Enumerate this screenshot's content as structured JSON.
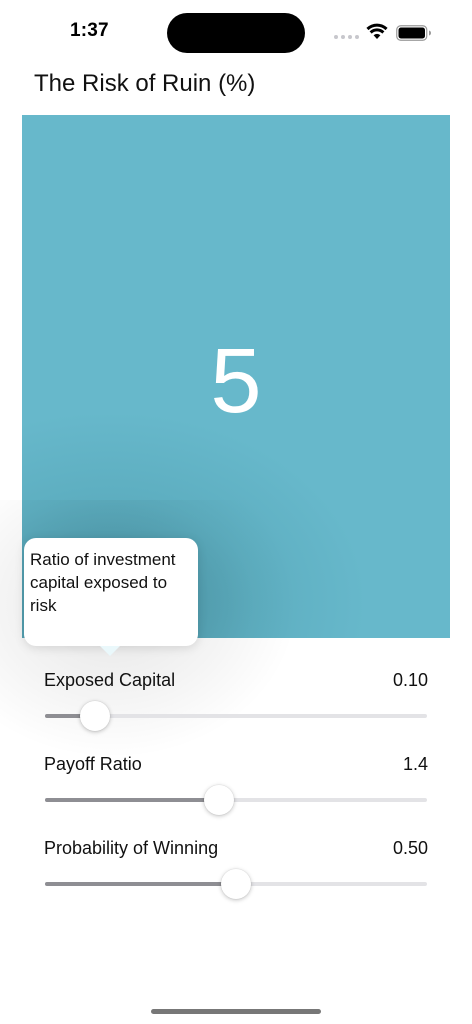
{
  "status_bar": {
    "time": "1:37"
  },
  "title": "The Risk of Ruin (%)",
  "result": {
    "value": "5"
  },
  "tooltip": {
    "text": "Ratio of investment capital exposed to risk"
  },
  "controls": [
    {
      "label": "Exposed Capital",
      "value": "0.10",
      "fraction": 0.13
    },
    {
      "label": "Payoff Ratio",
      "value": "1.4",
      "fraction": 0.455
    },
    {
      "label": "Probability of Winning",
      "value": "0.50",
      "fraction": 0.5
    }
  ],
  "colors": {
    "panel": "#67b8cb",
    "slider_fill": "#8e8e93",
    "slider_track": "#e3e3e6"
  }
}
